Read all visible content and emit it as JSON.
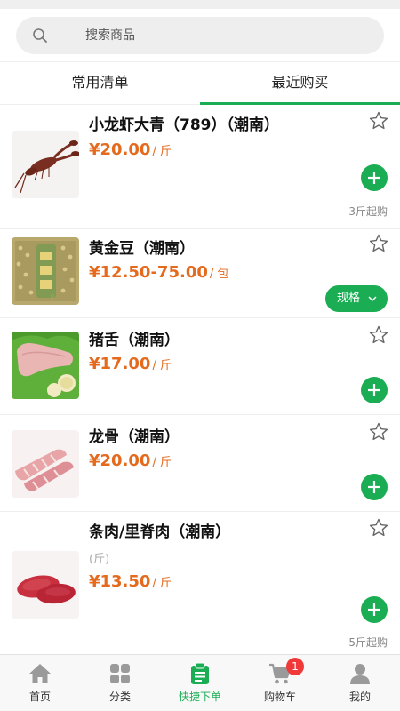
{
  "search": {
    "placeholder": "搜索商品",
    "icon": "search-icon"
  },
  "tabs": [
    {
      "label": "常用清单",
      "active": false
    },
    {
      "label": "最近购买",
      "active": true
    }
  ],
  "colors": {
    "accent": "#1aad54",
    "price": "#e46a1e",
    "badge": "#f03a3a"
  },
  "products": [
    {
      "name": "小龙虾大青（789）（潮南）",
      "price": "¥20.00",
      "unit": "/ 斤",
      "action": "add",
      "min_order": "3斤起购"
    },
    {
      "name": "黄金豆（潮南）",
      "price": "¥12.50-75.00",
      "unit": "/ 包",
      "action": "spec",
      "spec_label": "规格"
    },
    {
      "name": "猪舌（潮南）",
      "price": "¥17.00",
      "unit": "/ 斤",
      "action": "add"
    },
    {
      "name": "龙骨（潮南）",
      "price": "¥20.00",
      "unit": "/ 斤",
      "action": "add"
    },
    {
      "name": "条肉/里脊肉（潮南）",
      "spec_note": "(斤)",
      "price": "¥13.50",
      "unit": "/ 斤",
      "action": "add",
      "min_order": "5斤起购"
    }
  ],
  "tabbar": [
    {
      "label": "首页",
      "icon": "home-icon",
      "active": false
    },
    {
      "label": "分类",
      "icon": "category-icon",
      "active": false
    },
    {
      "label": "快捷下单",
      "icon": "quick-order-icon",
      "active": true
    },
    {
      "label": "购物车",
      "icon": "cart-icon",
      "active": false,
      "badge": "1"
    },
    {
      "label": "我的",
      "icon": "profile-icon",
      "active": false
    }
  ]
}
